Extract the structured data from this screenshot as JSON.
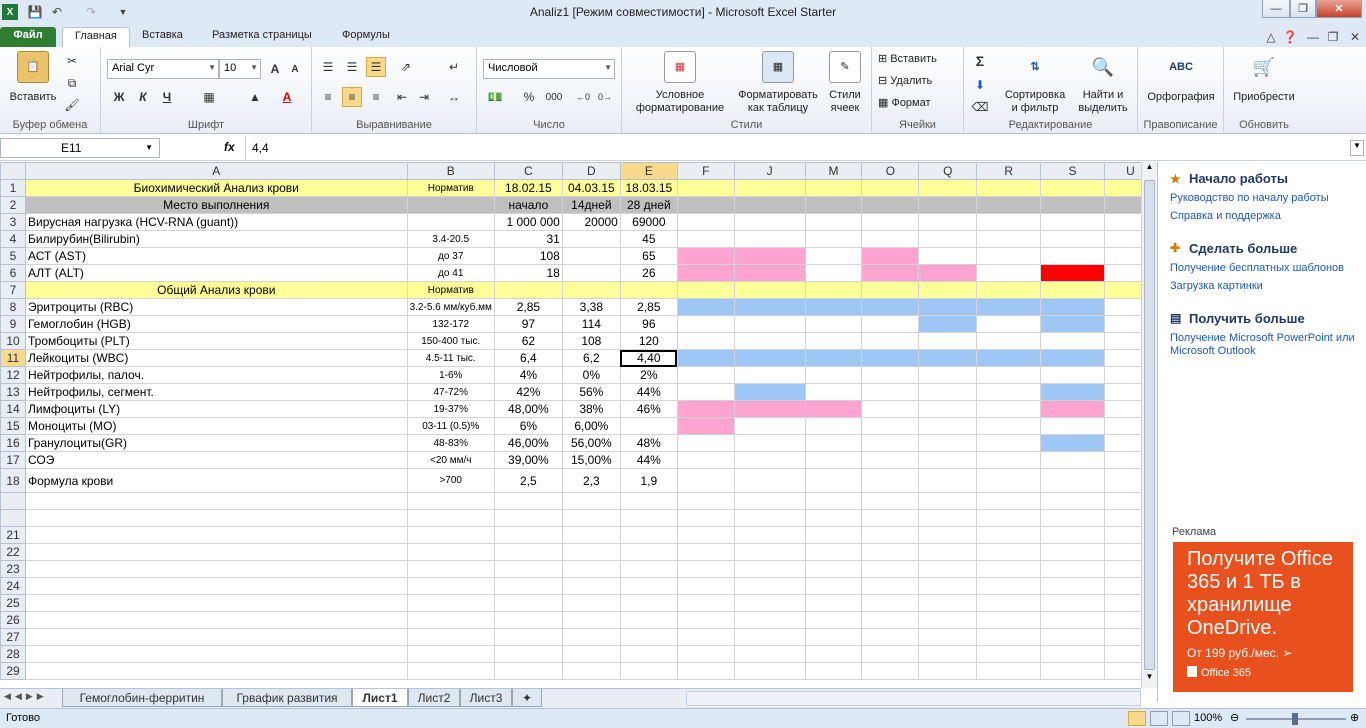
{
  "window": {
    "title": "Analiz1  [Режим совместимости]  -  Microsoft Excel Starter"
  },
  "tabs": [
    "Файл",
    "Главная",
    "Вставка",
    "Разметка страницы",
    "Формулы"
  ],
  "ribbon": {
    "clipboard": {
      "label": "Буфер обмена",
      "paste": "Вставить"
    },
    "font": {
      "label": "Шрифт",
      "name": "Arial Cyr",
      "size": "10",
      "bold": "Ж",
      "italic": "К",
      "underline": "Ч",
      "grow": "A",
      "shrink": "A"
    },
    "align": {
      "label": "Выравнивание"
    },
    "number": {
      "label": "Число",
      "format": "Числовой",
      "percent": "%",
      "thousands": "000"
    },
    "styles": {
      "label": "Стили",
      "cond1": "Условное",
      "cond2": "форматирование",
      "fmt1": "Форматировать",
      "fmt2": "как таблицу",
      "cell1": "Стили",
      "cell2": "ячеек"
    },
    "cells": {
      "label": "Ячейки",
      "insert": "Вставить",
      "delete": "Удалить",
      "format": "Формат"
    },
    "edit": {
      "label": "Редактирование",
      "sum": "Σ",
      "sort1": "Сортировка",
      "sort2": "и фильтр",
      "find1": "Найти и",
      "find2": "выделить"
    },
    "spell": {
      "label": "Правописание",
      "btn": "Орфография",
      "abc": "ABC"
    },
    "update": {
      "label": "Обновить",
      "btn": "Приобрести"
    }
  },
  "formula_bar": {
    "name": "E11",
    "fx": "fx",
    "value": "4,4"
  },
  "columns": [
    "A",
    "B",
    "C",
    "D",
    "E",
    "F",
    "J",
    "M",
    "O",
    "Q",
    "R",
    "S",
    "U"
  ],
  "rows": [
    {
      "n": "1",
      "a": "Биохимический Анализ крови",
      "b": "Норматив",
      "c": "18.02.15",
      "d": "04.03.15",
      "e": "18.03.15"
    },
    {
      "n": "2",
      "a": "Место выполнения",
      "b": "",
      "c": "начало",
      "d": "14дней",
      "e": "28 дней"
    },
    {
      "n": "3",
      "a": "Вирусная нагрузка (HCV-RNA (guant))",
      "b": "",
      "c": "1 000 000",
      "d": "20000",
      "e": "69000"
    },
    {
      "n": "4",
      "a": "Билирубин(Bilirubin)",
      "b": "3.4-20.5",
      "c": "31",
      "d": "",
      "e": "45"
    },
    {
      "n": "5",
      "a": "АСТ (AST)",
      "b": "до 37",
      "c": "108",
      "d": "",
      "e": "65"
    },
    {
      "n": "6",
      "a": "АЛТ (ALT)",
      "b": "до 41",
      "c": "18",
      "d": "",
      "e": "26"
    },
    {
      "n": "7",
      "a": "Общий Анализ крови",
      "b": "Норматив",
      "c": "",
      "d": "",
      "e": ""
    },
    {
      "n": "8",
      "a": "Эритроциты (RBC)",
      "b": "3.2-5.6 мм/куб.мм",
      "c": "2,85",
      "d": "3,38",
      "e": "2,85"
    },
    {
      "n": "9",
      "a": "Гемоглобин (HGB)",
      "b": "132-172",
      "c": "97",
      "d": "114",
      "e": "96"
    },
    {
      "n": "10",
      "a": "Тромбоциты (PLT)",
      "b": "150-400 тыс.",
      "c": "62",
      "d": "108",
      "e": "120"
    },
    {
      "n": "11",
      "a": "Лейкоциты (WBC)",
      "b": "4.5-11 тыс.",
      "c": "6,4",
      "d": "6,2",
      "e": "4,40"
    },
    {
      "n": "12",
      "a": "Нейтрофилы, палоч.",
      "b": "1-6%",
      "c": "4%",
      "d": "0%",
      "e": "2%"
    },
    {
      "n": "13",
      "a": "Нейтрофилы, сегмент.",
      "b": "47-72%",
      "c": "42%",
      "d": "56%",
      "e": "44%"
    },
    {
      "n": "14",
      "a": "Лимфоциты (LY)",
      "b": "19-37%",
      "c": "48,00%",
      "d": "38%",
      "e": "46%"
    },
    {
      "n": "15",
      "a": "Моноциты (MO)",
      "b": "03-11 (0.5)%",
      "c": "6%",
      "d": "6,00%",
      "e": ""
    },
    {
      "n": "16",
      "a": "Гранулоциты(GR)",
      "b": "48-83%",
      "c": "46,00%",
      "d": "56,00%",
      "e": "48%"
    },
    {
      "n": "17",
      "a": "СОЭ",
      "b": "<20 мм/ч",
      "c": "39,00%",
      "d": "15,00%",
      "e": "44%"
    },
    {
      "n": "18",
      "a": "Формула крови",
      "b": ">700",
      "c": "2,5",
      "d": "2,3",
      "e": "1,9"
    },
    {
      "n": "",
      "a": "",
      "b": "",
      "c": "",
      "d": "",
      "e": ""
    },
    {
      "n": "",
      "a": "",
      "b": "",
      "c": "",
      "d": "",
      "e": ""
    },
    {
      "n": "21"
    },
    {
      "n": "22"
    },
    {
      "n": "23"
    },
    {
      "n": "24"
    },
    {
      "n": "25"
    },
    {
      "n": "26"
    },
    {
      "n": "27"
    },
    {
      "n": "28"
    },
    {
      "n": "29"
    }
  ],
  "fills": {
    "5": [
      "pk",
      "pk",
      "",
      "pk",
      "",
      "",
      ""
    ],
    "6": [
      "pk",
      "pk",
      "",
      "pk",
      "pk",
      "",
      "rd"
    ],
    "8": [
      "bl",
      "bl",
      "bl",
      "bl",
      "bl",
      "bl",
      "bl"
    ],
    "9": [
      "",
      "",
      "",
      "",
      "bl",
      "",
      "bl"
    ],
    "11": [
      "bl",
      "bl",
      "bl",
      "bl",
      "bl",
      "bl",
      "bl"
    ],
    "13": [
      "",
      "bl",
      "",
      "",
      "",
      "",
      "bl"
    ],
    "14": [
      "pk",
      "pk",
      "pk",
      "",
      "",
      "",
      "pk"
    ],
    "15": [
      "pk",
      "",
      "",
      "",
      "",
      "",
      ""
    ],
    "16": [
      "",
      "",
      "",
      "",
      "",
      "",
      "bl"
    ]
  },
  "taskpane": {
    "h1": "Начало работы",
    "l1": "Руководство по началу работы",
    "l2": "Справка и поддержка",
    "h2": "Сделать больше",
    "l3": "Получение бесплатных шаблонов",
    "l4": "Загрузка картинки",
    "h3": "Получить больше",
    "l5": "Получение Microsoft PowerPoint или Microsoft Outlook",
    "ad_label": "Реклама",
    "ad_text": "Получите Office 365 и 1 ТБ в хранилище OneDrive.",
    "ad_price": "От 199 руб./мес.",
    "ad_brand": "Office 365"
  },
  "sheets": [
    "Гемоглобин-ферритин",
    "Грвафик развития",
    "Лист1",
    "Лист2",
    "Лист3"
  ],
  "active_sheet": "Лист1",
  "status": {
    "ready": "Готово",
    "zoom": "100%"
  }
}
